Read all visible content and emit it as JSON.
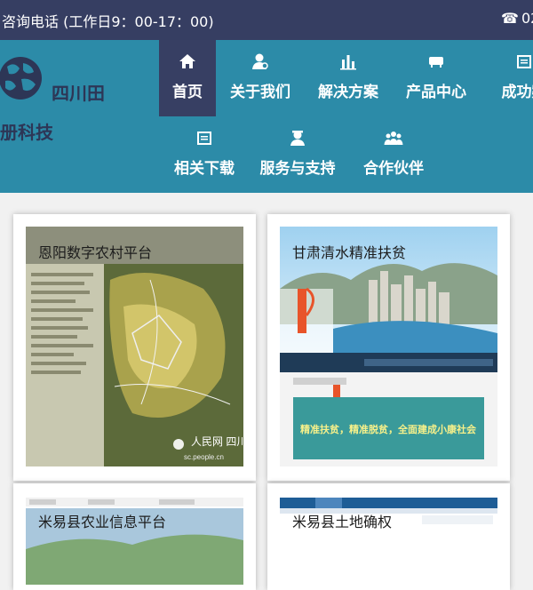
{
  "topbar": {
    "hotline_text": "咨询电话 (工作日9：00-17：00)",
    "phone_text": "02",
    "phone_icon": "phone-icon"
  },
  "logo": {
    "line1": "四川田",
    "line2": "册科技"
  },
  "nav": {
    "items": [
      {
        "label": "首页",
        "icon": "home-icon",
        "active": true
      },
      {
        "label": "关于我们",
        "icon": "user-icon"
      },
      {
        "label": "解决方案",
        "icon": "bars-icon"
      },
      {
        "label": "产品中心",
        "icon": "box-icon"
      },
      {
        "label": "成功案",
        "icon": "case-icon"
      },
      {
        "label": "相关下载",
        "icon": "download-icon"
      },
      {
        "label": "服务与支持",
        "icon": "support-icon"
      },
      {
        "label": "合作伙伴",
        "icon": "partners-icon"
      }
    ]
  },
  "cases": [
    {
      "title": "恩阳数字农村平台",
      "watermark": "人民网 四川频道",
      "watermark_url": "sc.people.cn"
    },
    {
      "title": "甘肃清水精准扶贫",
      "banner_text": "精准扶贫，精准脱贫，全面建成小康社会"
    },
    {
      "title": "米易县农业信息平台"
    },
    {
      "title": "米易县土地确权"
    }
  ],
  "colors": {
    "topbar": "#363e62",
    "navbar": "#2c8ba8",
    "nav_active": "#373f63",
    "logo_text": "#2d3656"
  }
}
